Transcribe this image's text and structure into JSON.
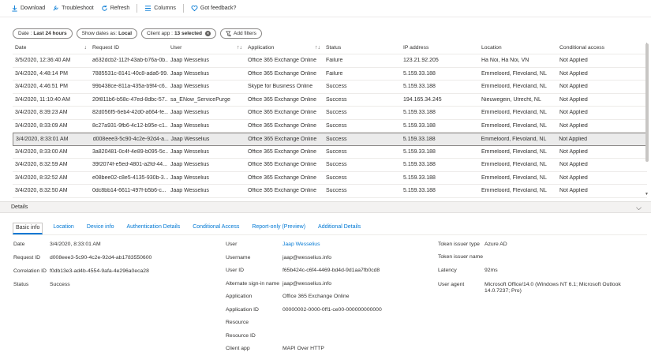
{
  "toolbar": {
    "download": "Download",
    "troubleshoot": "Troubleshoot",
    "refresh": "Refresh",
    "columns": "Columns",
    "feedback": "Got feedback?"
  },
  "filters": {
    "date_label": "Date :",
    "date_value": "Last 24 hours",
    "show_dates_label": "Show dates as:",
    "show_dates_value": "Local",
    "client_app_label": "Client app :",
    "client_app_value": "13 selected",
    "add_filters": "Add filters"
  },
  "table": {
    "headers": [
      "Date",
      "Request ID",
      "User",
      "Application",
      "Status",
      "IP address",
      "Location",
      "Conditional access"
    ],
    "rows": [
      [
        "3/5/2020, 12:36:40 AM",
        "a632dcb2-112f-43ab-b76a-0b...",
        "Jaap Wesselius",
        "Office 365 Exchange Online",
        "Failure",
        "123.21.92.205",
        "Ha Noi, Ha Noi, VN",
        "Not Applied"
      ],
      [
        "3/4/2020, 4:48:14 PM",
        "7885531c-8141-40c8-ada6-99...",
        "Jaap Wesselius",
        "Office 365 Exchange Online",
        "Failure",
        "5.159.33.188",
        "Emmeloord, Flevoland, NL",
        "Not Applied"
      ],
      [
        "3/4/2020, 4:46:51 PM",
        "99b438ce-811a-435a-b9f4-c6...",
        "Jaap Wesselius",
        "Skype for Business Online",
        "Success",
        "5.159.33.188",
        "Emmeloord, Flevoland, NL",
        "Not Applied"
      ],
      [
        "3/4/2020, 11:10:40 AM",
        "20f811b6-b58c-47ed-8dbc-57...",
        "sa_ENow_ServicePurge",
        "Office 365 Exchange Online",
        "Success",
        "194.165.34.245",
        "Nieuwegein, Utrecht, NL",
        "Not Applied"
      ],
      [
        "3/4/2020, 8:39:23 AM",
        "82d056f5-6eb4-42d0-a664-fe...",
        "Jaap Wesselius",
        "Office 365 Exchange Online",
        "Success",
        "5.159.33.188",
        "Emmeloord, Flevoland, NL",
        "Not Applied"
      ],
      [
        "3/4/2020, 8:33:09 AM",
        "8c27a931-9fb6-4c12-b95e-c1...",
        "Jaap Wesselius",
        "Office 365 Exchange Online",
        "Success",
        "5.159.33.188",
        "Emmeloord, Flevoland, NL",
        "Not Applied"
      ],
      [
        "3/4/2020, 8:33:01 AM",
        "d008eee3-5c90-4c2e-92d4-a...",
        "Jaap Wesselius",
        "Office 365 Exchange Online",
        "Success",
        "5.159.33.188",
        "Emmeloord, Flevoland, NL",
        "Not Applied"
      ],
      [
        "3/4/2020, 8:33:00 AM",
        "3a820481-0c4f-4e89-b095-5c...",
        "Jaap Wesselius",
        "Office 365 Exchange Online",
        "Success",
        "5.159.33.188",
        "Emmeloord, Flevoland, NL",
        "Not Applied"
      ],
      [
        "3/4/2020, 8:32:59 AM",
        "39f2074f-e5ed-4801-a2fd-44...",
        "Jaap Wesselius",
        "Office 365 Exchange Online",
        "Success",
        "5.159.33.188",
        "Emmeloord, Flevoland, NL",
        "Not Applied"
      ],
      [
        "3/4/2020, 8:32:52 AM",
        "e08bee02-c8e5-4135-930b-3...",
        "Jaap Wesselius",
        "Office 365 Exchange Online",
        "Success",
        "5.159.33.188",
        "Emmeloord, Flevoland, NL",
        "Not Applied"
      ],
      [
        "3/4/2020, 8:32:50 AM",
        "0dc8bb14-6611-497f-b5b6-c...",
        "Jaap Wesselius",
        "Office 365 Exchange Online",
        "Success",
        "5.159.33.188",
        "Emmeloord, Flevoland, NL",
        "Not Applied"
      ]
    ],
    "selected_row": 6
  },
  "details": {
    "title": "Details",
    "tabs": [
      "Basic info",
      "Location",
      "Device info",
      "Authentication Details",
      "Conditional Access",
      "Report-only (Preview)",
      "Additional Details"
    ],
    "col1": [
      {
        "k": "Date",
        "v": "3/4/2020, 8:33:01 AM"
      },
      {
        "k": "Request ID",
        "v": "d008eee3-5c90-4c2e-92d4-ab1783550600"
      },
      {
        "k": "Correlation ID",
        "v": "f0db13e3-ad4b-4554-9afa-4e296a0eca28"
      },
      {
        "k": "Status",
        "v": "Success"
      }
    ],
    "col2": [
      {
        "k": "User",
        "v": "Jaap Wesselius"
      },
      {
        "k": "Username",
        "v": "jaap@wesselius.info"
      },
      {
        "k": "User ID",
        "v": "f65b424c-c6f4-4469-bd4d-9d1aa7fb0cd8"
      },
      {
        "k": "Alternate sign-in name",
        "v": "jaap@wesselius.info"
      },
      {
        "k": "Application",
        "v": "Office 365 Exchange Online"
      },
      {
        "k": "Application ID",
        "v": "00000002-0000-0ff1-ce00-000000000000"
      },
      {
        "k": "Resource",
        "v": ""
      },
      {
        "k": "Resource ID",
        "v": ""
      },
      {
        "k": "Client app",
        "v": "MAPI Over HTTP"
      }
    ],
    "col3": [
      {
        "k": "Token issuer type",
        "v": "Azure AD"
      },
      {
        "k": "Token issuer name",
        "v": ""
      },
      {
        "k": "Latency",
        "v": "92ms"
      },
      {
        "k": "User agent",
        "v": "Microsoft Office/14.0 (Windows NT 6.1; Microsoft Outlook"
      },
      {
        "k": "",
        "v": "14.0.7237; Pro)"
      }
    ]
  }
}
